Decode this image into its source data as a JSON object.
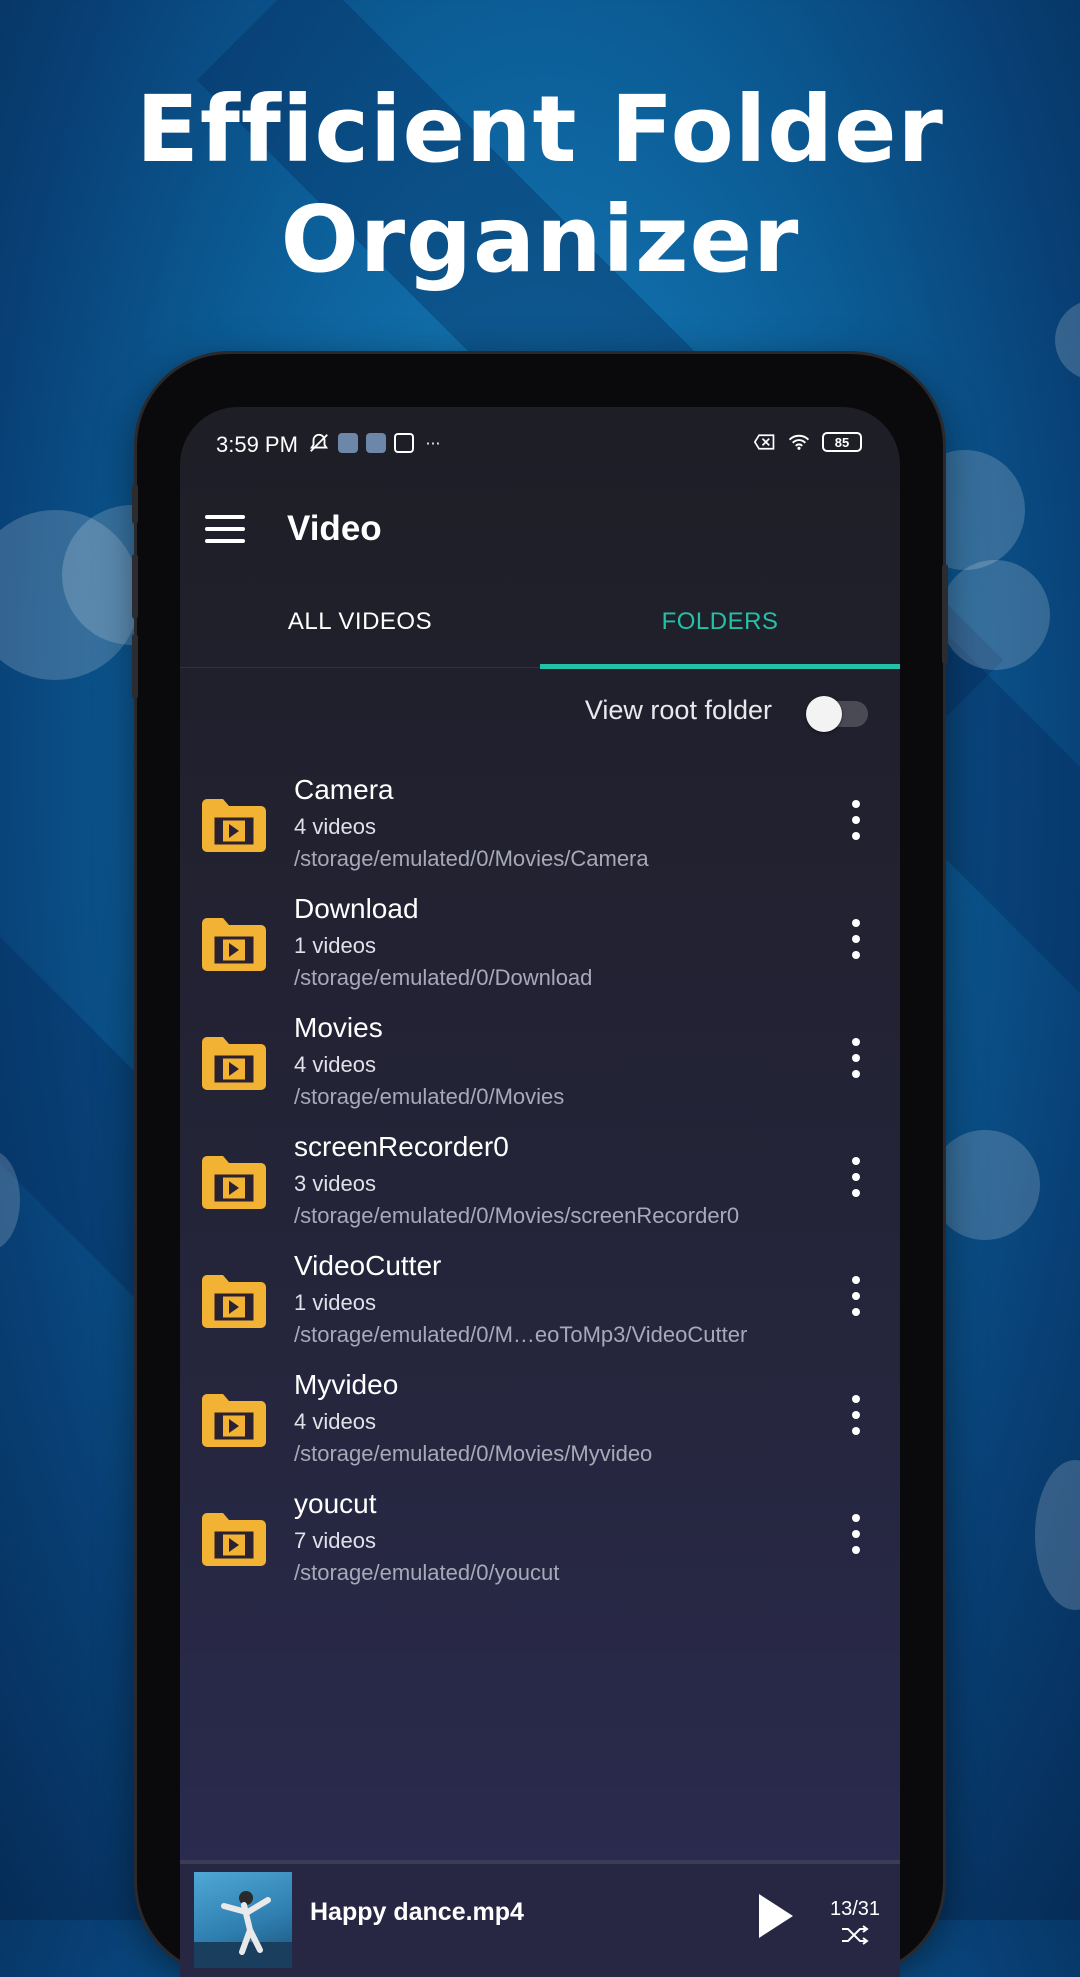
{
  "headline": {
    "line1": "Efficient Folder",
    "line2": "Organizer"
  },
  "status_bar": {
    "time": "3:59 PM",
    "battery": "85",
    "icons": [
      "muted-bell-icon",
      "app-notification-icon",
      "app-notification-icon",
      "app-notification-icon",
      "more-dots-icon",
      "sim-icon",
      "wifi-icon",
      "battery-icon"
    ]
  },
  "app_bar": {
    "title": "Video"
  },
  "tabs": [
    {
      "label": "ALL VIDEOS",
      "selected": false
    },
    {
      "label": "FOLDERS",
      "selected": true
    }
  ],
  "root_folder": {
    "label": "View root folder",
    "enabled": false
  },
  "folders": [
    {
      "name": "Camera",
      "count": "4 videos",
      "path": "/storage/emulated/0/Movies/Camera"
    },
    {
      "name": "Download",
      "count": "1 videos",
      "path": "/storage/emulated/0/Download"
    },
    {
      "name": "Movies",
      "count": "4 videos",
      "path": "/storage/emulated/0/Movies"
    },
    {
      "name": "screenRecorder0",
      "count": "3 videos",
      "path": "/storage/emulated/0/Movies/screenRecorder0"
    },
    {
      "name": "VideoCutter",
      "count": "1 videos",
      "path": "/storage/emulated/0/M…eoToMp3/VideoCutter"
    },
    {
      "name": "Myvideo",
      "count": "4 videos",
      "path": "/storage/emulated/0/Movies/Myvideo"
    },
    {
      "name": "youcut",
      "count": "7 videos",
      "path": "/storage/emulated/0/youcut"
    }
  ],
  "mini_player": {
    "title": "Happy dance.mp4",
    "position": "13/31"
  },
  "colors": {
    "accent": "#23c2a8",
    "folder": "#f2b233",
    "background": "#0c5f99"
  }
}
